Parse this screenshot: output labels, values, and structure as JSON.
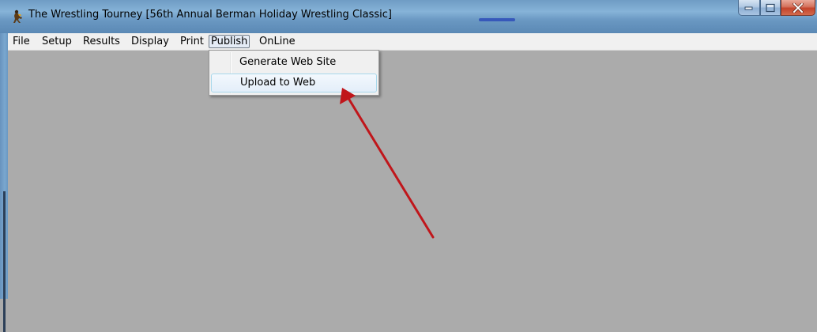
{
  "window": {
    "title": "The Wrestling Tourney [56th Annual Berman Holiday Wrestling Classic]",
    "app_icon": "wrestler-icon",
    "controls": {
      "minimize_icon": "minimize-icon",
      "maximize_icon": "maximize-icon",
      "close_icon": "close-icon"
    }
  },
  "menubar": {
    "items": [
      {
        "label": "File"
      },
      {
        "label": "Setup"
      },
      {
        "label": "Results"
      },
      {
        "label": "Display"
      },
      {
        "label": "Print"
      },
      {
        "label": "Publish",
        "open": true
      },
      {
        "label": "OnLine"
      }
    ]
  },
  "publish_menu": {
    "items": [
      {
        "label": "Generate Web Site"
      },
      {
        "label": "Upload to Web",
        "highlighted": true
      }
    ]
  },
  "annotation": {
    "arrow_color": "#c0161b"
  },
  "colors": {
    "workspace": "#ababab",
    "menubar": "#f0f0f0",
    "close_button": "#c4432b"
  }
}
